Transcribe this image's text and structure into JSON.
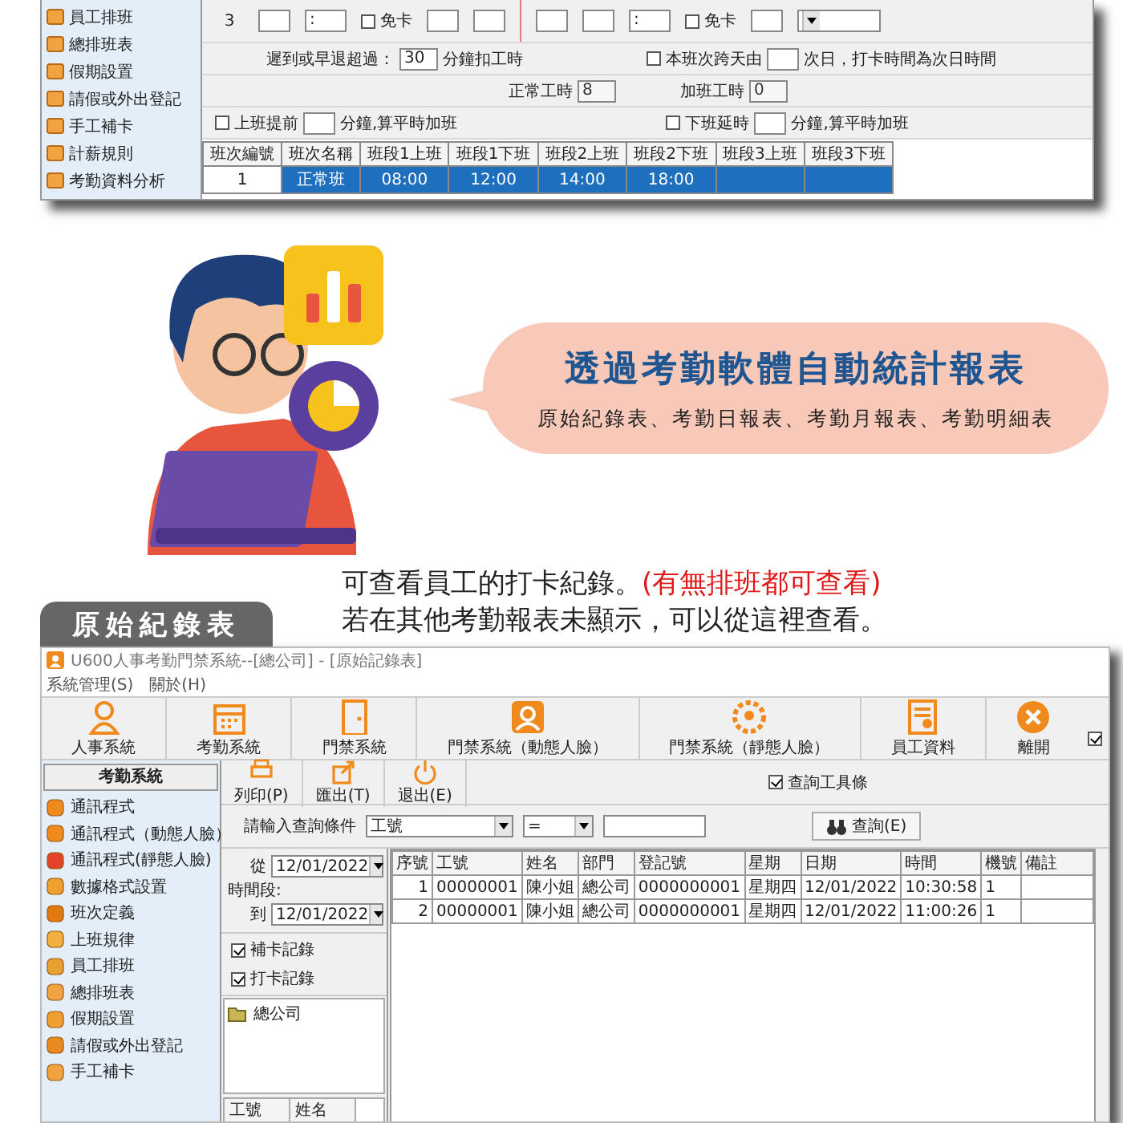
{
  "top_window": {
    "sidebar": [
      "員工排班",
      "總排班表",
      "假期設置",
      "請假或外出登記",
      "手工補卡",
      "計薪規則",
      "考勤資料分析"
    ],
    "shift_row": {
      "number": "3",
      "items": [
        {
          "kind": "box"
        },
        {
          "kind": "time",
          "text": ":"
        },
        {
          "kind": "check",
          "label": "免卡",
          "checked": false
        },
        {
          "kind": "box"
        },
        {
          "kind": "box"
        },
        {
          "kind": "divider"
        },
        {
          "kind": "box"
        },
        {
          "kind": "box"
        },
        {
          "kind": "time",
          "text": ":"
        },
        {
          "kind": "check",
          "label": "免卡",
          "checked": false
        },
        {
          "kind": "box"
        },
        {
          "kind": "select"
        }
      ]
    },
    "late_rule": {
      "label": "遲到或早退超過：",
      "value": "30",
      "suffix": "分鐘扣工時"
    },
    "cross_day": {
      "checked": false,
      "label": "本班次跨天由",
      "suffix": "次日，打卡時間為次日時間"
    },
    "hours": [
      {
        "label": "正常工時",
        "value": "8"
      },
      {
        "label": "加班工時",
        "value": "0"
      }
    ],
    "overtime": [
      {
        "checked": false,
        "label": "上班提前",
        "suffix": "分鐘,算平時加班"
      },
      {
        "checked": false,
        "label": "下班延時",
        "suffix": "分鐘,算平時加班"
      }
    ],
    "shift_table": {
      "columns": [
        "班次編號",
        "班次名稱",
        "班段1上班",
        "班段1下班",
        "班段2上班",
        "班段2下班",
        "班段3上班",
        "班段3下班"
      ],
      "rows": [
        {
          "selected": true,
          "cells": [
            "1",
            "正常班",
            "08:00",
            "12:00",
            "14:00",
            "18:00",
            "",
            ""
          ]
        }
      ]
    }
  },
  "promo": {
    "title": "透過考勤軟體自動統計報表",
    "subtitle": "原始紀錄表、考勤日報表、考勤月報表、考勤明細表"
  },
  "caption": [
    [
      {
        "kind": "plain",
        "text": "可查看員工的打卡紀錄。"
      },
      {
        "kind": "highlight",
        "text": "(有無排班都可查看)"
      }
    ],
    [
      {
        "kind": "plain",
        "text": "若在其他考勤報表未顯示，可以從這裡查看。"
      }
    ]
  ],
  "section_badge": "原始紀錄表",
  "window": {
    "title": "U600人事考勤門禁系統--[總公司] - [原始記錄表]",
    "menu": [
      "系統管理(S)",
      "關於(H)"
    ],
    "toolbar": [
      "人事系統",
      "考勤系統",
      "門禁系統",
      "門禁系統（動態人臉）",
      "門禁系統（靜態人臉）",
      "員工資料",
      "離開"
    ],
    "toolbar_check": {
      "checked": true
    }
  },
  "sidebar": {
    "header": "考勤系統",
    "items": [
      "通訊程式",
      "通訊程式（動態人臉）",
      "通訊程式(靜態人臉)",
      "數據格式設置",
      "班次定義",
      "上班規律",
      "員工排班",
      "總排班表",
      "假期設置",
      "請假或外出登記",
      "手工補卡"
    ]
  },
  "actions": [
    "列印(P)",
    "匯出(T)",
    "退出(E)"
  ],
  "toolbar_toggle": {
    "label": "查詢工具條",
    "checked": true
  },
  "query": {
    "label": "請輸入查詢條件",
    "field": "工號",
    "operator": "=",
    "button": "查詢(E)"
  },
  "period": {
    "label": "時間段:",
    "from_label": "從",
    "from": "12/01/2022",
    "to_label": "到",
    "to": "12/01/2022"
  },
  "filters": [
    {
      "label": "補卡記錄",
      "checked": true
    },
    {
      "label": "打卡記錄",
      "checked": true
    }
  ],
  "tree": [
    "總公司"
  ],
  "employee_list": {
    "columns": [
      "工號",
      "姓名"
    ]
  },
  "records": {
    "columns": [
      "序號",
      "工號",
      "姓名",
      "部門",
      "登記號",
      "星期",
      "日期",
      "時間",
      "機號",
      "備註"
    ],
    "rows": [
      [
        "1",
        "00000001",
        "陳小姐",
        "總公司",
        "0000000001",
        "星期四",
        "12/01/2022",
        "10:30:58",
        "1",
        ""
      ],
      [
        "2",
        "00000001",
        "陳小姐",
        "總公司",
        "0000000001",
        "星期四",
        "12/01/2022",
        "11:00:26",
        "1",
        ""
      ]
    ]
  }
}
